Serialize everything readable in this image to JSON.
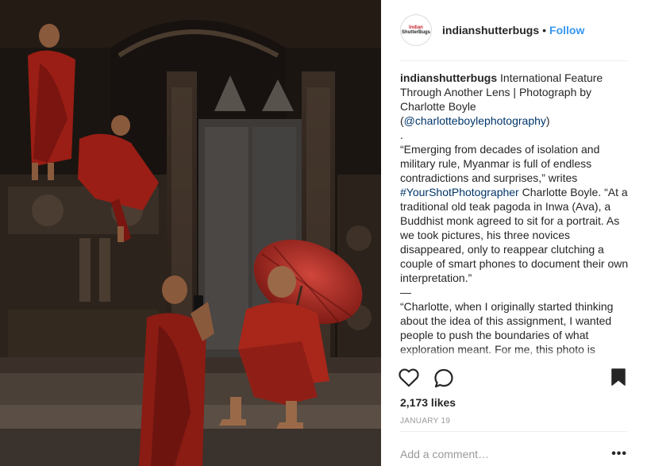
{
  "post": {
    "photo_alt": "Buddhist monk with red umbrella and three novices at a teak pagoda",
    "header": {
      "avatar_text_line1": "Indian",
      "avatar_text_line2": "ShutterBugs",
      "username": "indianshutterbugs",
      "separator": "•",
      "follow_label": "Follow"
    },
    "caption": {
      "author": "indianshutterbugs",
      "line1": "International Feature Through Another Lens | Photograph by Charlotte Boyle",
      "mention": "@charlotteboylephotography",
      "paren_open": "(",
      "paren_close": ")",
      "dot_line": ".",
      "para1_a": "“Emerging from decades of isolation and military rule, Myanmar is full of endless contradictions and surprises,” writes ",
      "hashtag": "#YourShotPhotographer",
      "para1_b": " Charlotte Boyle. “At a traditional old teak pagoda in Inwa (Ava), a Buddhist monk agreed to sit for a portrait. As we took pictures, his three novices disappeared, only to reappear clutching a couple of smart phones to document their own interpretation.”",
      "dash_line": "—",
      "para2": "“Charlotte, when I originally started thinking about the idea of this assignment, I wanted people to push the boundaries of what exploration meant. For me, this photo is beautiful because it captures what it"
    },
    "actions": {
      "like_icon": "heart-icon",
      "comment_icon": "comment-icon",
      "save_icon": "bookmark-icon"
    },
    "likes": "2,173 likes",
    "date": "JANUARY 19",
    "comment": {
      "placeholder": "Add a comment…",
      "value": "",
      "more_label": "•••"
    }
  },
  "colors": {
    "link": "#3897f0",
    "text": "#262626",
    "muted": "#999999",
    "mention": "#003569",
    "divider": "#efefef"
  }
}
